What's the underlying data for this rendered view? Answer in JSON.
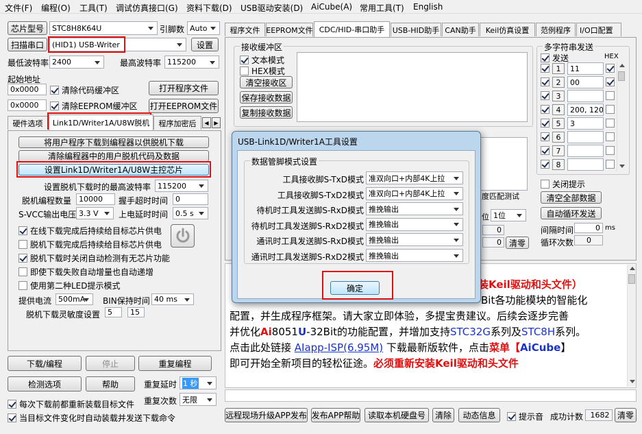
{
  "menu": [
    "文件(F)",
    "编程(O)",
    "工具(T)",
    "调试仿真接口(G)",
    "资料下载(D)",
    "USB驱动安装(D)",
    "AiCube(A)",
    "常用工具(T)",
    "English"
  ],
  "left": {
    "chip_btn": "芯片型号",
    "chip_value": "STC8H8K64U",
    "pin_label": "引脚数",
    "pin_value": "Auto",
    "scan_btn": "扫描串口",
    "port_value": "(HID1) USB-Writer",
    "settings_btn": "设置",
    "min_baud_label": "最低波特率",
    "min_baud": "2400",
    "max_baud_label": "最高波特率",
    "max_baud": "115200",
    "start_addr_label": "起始地址",
    "addr1": "0x0000",
    "clear_code": "清除代码缓冲区",
    "open_prog": "打开程序文件",
    "addr2": "0x0000",
    "clear_eeprom": "清除EEPROM缓冲区",
    "open_eeprom": "打开EEPROM文件",
    "tabs": [
      "硬件选项",
      "Link1D/Writer1A/U8W脱机",
      "程序加密后"
    ],
    "btn_download_prog": "将用户程序下载到编程器以供脱机下载",
    "btn_clear_prog": "清除编程器中的用户脱机代码及数据",
    "btn_set_link": "设置Link1D/Writer1A/U8W主控芯片",
    "max_baud_offline_label": "设置脱机下载时的最高波特率",
    "max_baud_offline": "115200",
    "offline_count_label": "脱机编程数量",
    "offline_count": "10000",
    "handshake_label": "握手超时时间",
    "handshake": "0",
    "svcc_label": "S-VCC输出电压",
    "svcc": "3.3 V",
    "power_delay_label": "上电延时时间",
    "power_delay": "0.5 s",
    "opt1": "在线下载完成后持续给目标芯片供电",
    "opt2": "脱机下载完成后持续给目标芯片供电",
    "opt3": "脱机下载时关闭自动检测有无芯片功能",
    "opt4": "即使下载失败自动增量也自动递增",
    "opt5": "使用第二种LED提示模式",
    "current_label": "提供电流",
    "current": "500mA",
    "bin_hold_label": "BIN保持时间",
    "bin_hold": "40 ms",
    "sensitivity_label": "脱机下载灵敏度设置",
    "sens1": "5",
    "sens2": "15",
    "download_btn": "下载/编程",
    "stop_btn": "停止",
    "reprog_btn": "重复编程",
    "check_btn": "检测选项",
    "help_btn": "帮助",
    "repeat_delay_label": "重复延时",
    "repeat_delay": "1 秒",
    "repeat_count_label": "重复次数",
    "repeat_count": "无限",
    "reload_each": "每次下载前都重新装载目标文件",
    "auto_send": "当目标文件变化时自动装载并发送下载命令"
  },
  "right": {
    "tabs": [
      "程序文件",
      "EEPROM文件",
      "CDC/HID-串口助手",
      "USB-HID助手",
      "CAN助手",
      "Keil仿真设置",
      "范例程序",
      "I/O口配置"
    ],
    "recv_label": "接收缓冲区",
    "text_mode": "文本模式",
    "hex_mode": "HEX模式",
    "clear_recv": "清空接收区",
    "save_recv": "保存接收数据",
    "copy_recv": "复制接收数据",
    "multi_send_label": "多字符串发送",
    "send_col": "发送",
    "hex_col": "HEX",
    "rows": [
      {
        "n": "1",
        "val": "11",
        "hex": true
      },
      {
        "n": "2",
        "val": "00",
        "hex": true
      },
      {
        "n": "3",
        "val": "",
        "hex": false
      },
      {
        "n": "4",
        "val": "200, 120,",
        "hex": false
      },
      {
        "n": "5",
        "val": "3",
        "hex": false
      },
      {
        "n": "6",
        "val": "",
        "hex": false
      },
      {
        "n": "7",
        "val": "",
        "hex": false
      },
      {
        "n": "8",
        "val": "",
        "hex": false
      }
    ],
    "close_prompt": "关闭提示",
    "clear_all": "清空全部数据",
    "auto_loop": "自动循环发送",
    "interval_label": "间隔时间",
    "interval": "0",
    "interval_unit": "ms",
    "loop_label": "循环次数",
    "loop": "0",
    "partial_match": "度匹配测试",
    "pos_label": "位",
    "pos_value": "1位",
    "zero1": "0",
    "zero2": "0",
    "clear_small": "清零",
    "info_line1_red": "装Keil驱动和头文件）",
    "info_line2": "Bit各功能模块的智能化",
    "info_line3": "配置，并生成程序框架。请大家立即体验，多提宝贵建议。后续会逐步完善",
    "info_line4_a": "并优化",
    "info_line4_ai": "Ai",
    "info_line4_b": "8051",
    "info_line4_u": "U",
    "info_line4_c": "-32Bit的功能配置，并增加支持",
    "info_line4_stc32": "STC32G",
    "info_line4_d": "系列及",
    "info_line4_stc8": "STC8H",
    "info_line4_e": "系列。",
    "info_line5_a": "点击此处链接 ",
    "info_line5_link": "AIapp-ISP(6.95M)",
    "info_line5_b": " 下载最新版软件，点击",
    "info_line5_menu": "菜单【",
    "info_line5_aicube": "AiCube",
    "info_line5_c": "】",
    "info_line6_a": "即可开始全新项目的轻松征途。",
    "info_line6_red": "必须重新安装Keil驱动和头文件",
    "bottom_btns": [
      "远程现场升级APP发布",
      "发布APP帮助",
      "读取本机硬盘号",
      "清除",
      "动态信息"
    ],
    "beep": "提示音",
    "success_label": "成功计数",
    "success_count": "1682",
    "clear_btn": "清零"
  },
  "dialog": {
    "title": "USB-Link1D/Writer1A工具设置",
    "group": "数据管脚模式设置",
    "rows": [
      {
        "label": "工具接收脚S-TxD模式",
        "value": "准双向口+内部4K上拉"
      },
      {
        "label": "工具接收脚S-TxD2模式",
        "value": "准双向口+内部4K上拉"
      },
      {
        "label": "待机时工具发送脚S-RxD模式",
        "value": "推挽输出"
      },
      {
        "label": "待机时工具发送脚S-RxD2模式",
        "value": "推挽输出"
      },
      {
        "label": "通讯时工具发送脚S-RxD模式",
        "value": "推挽输出"
      },
      {
        "label": "通讯时工具发送脚S-RxD2模式",
        "value": "推挽输出"
      }
    ],
    "ok": "确定"
  }
}
